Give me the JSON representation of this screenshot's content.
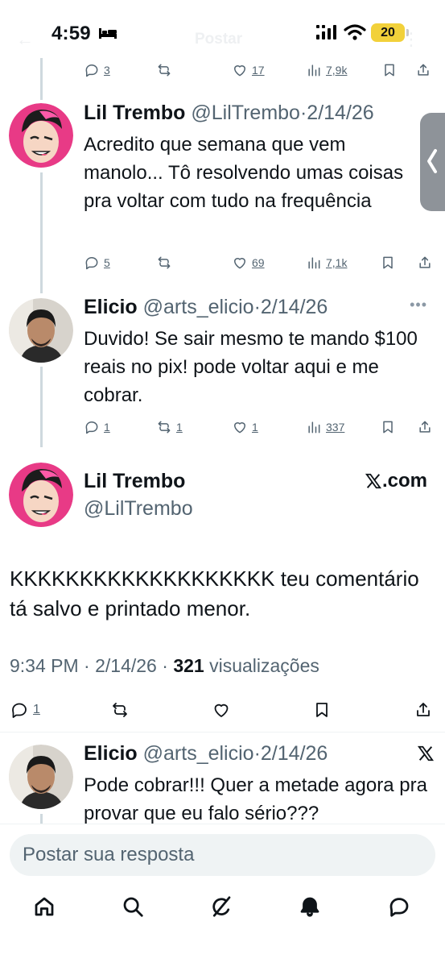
{
  "status": {
    "time": "4:59",
    "battery": "20"
  },
  "background_header": {
    "title": "Postar"
  },
  "thread": [
    {
      "id": "t0",
      "actions": {
        "replies": "3",
        "retweets": "",
        "likes": "17",
        "views": "7,9k"
      }
    },
    {
      "id": "t1",
      "name": "Lil Trembo",
      "handle": "@LilTrembo",
      "date": "2/14/26",
      "text": "Acredito que semana que vem manolo... Tô resolvendo umas coisas pra voltar com tudo na frequência",
      "actions": {
        "replies": "5",
        "retweets": "",
        "likes": "69",
        "views": "7,1k"
      }
    },
    {
      "id": "t2",
      "name": "Elicio",
      "handle": "@arts_elicio",
      "date": "2/14/26",
      "text": "Duvido! Se sair mesmo te mando $100 reais no pix! pode voltar aqui e me cobrar.",
      "actions": {
        "replies": "1",
        "retweets": "1",
        "likes": "1",
        "views": "337"
      }
    }
  ],
  "main_tweet": {
    "name": "Lil Trembo",
    "handle": "@LilTrembo",
    "source": ".com",
    "text": "KKKKKKKKKKKKKKKKKKK teu comentário tá salvo e printado menor.",
    "time": "9:34 PM",
    "date": "2/14/26",
    "views_count": "321",
    "views_label": "visualizações",
    "actions": {
      "replies": "1"
    }
  },
  "reply_preview": {
    "name": "Elicio",
    "handle": "@arts_elicio",
    "date": "2/14/26",
    "text": "Pode cobrar!!! Quer a metade agora pra provar que eu falo sério???"
  },
  "reply_box": {
    "placeholder": "Postar sua resposta"
  },
  "bottom_nav": [
    "home-icon",
    "search-icon",
    "grok-icon",
    "notifications-icon",
    "messages-icon"
  ],
  "colors": {
    "text": "#0f1419",
    "secondary": "#536471",
    "battery": "#f2d13a",
    "divider": "#eff3f4"
  }
}
